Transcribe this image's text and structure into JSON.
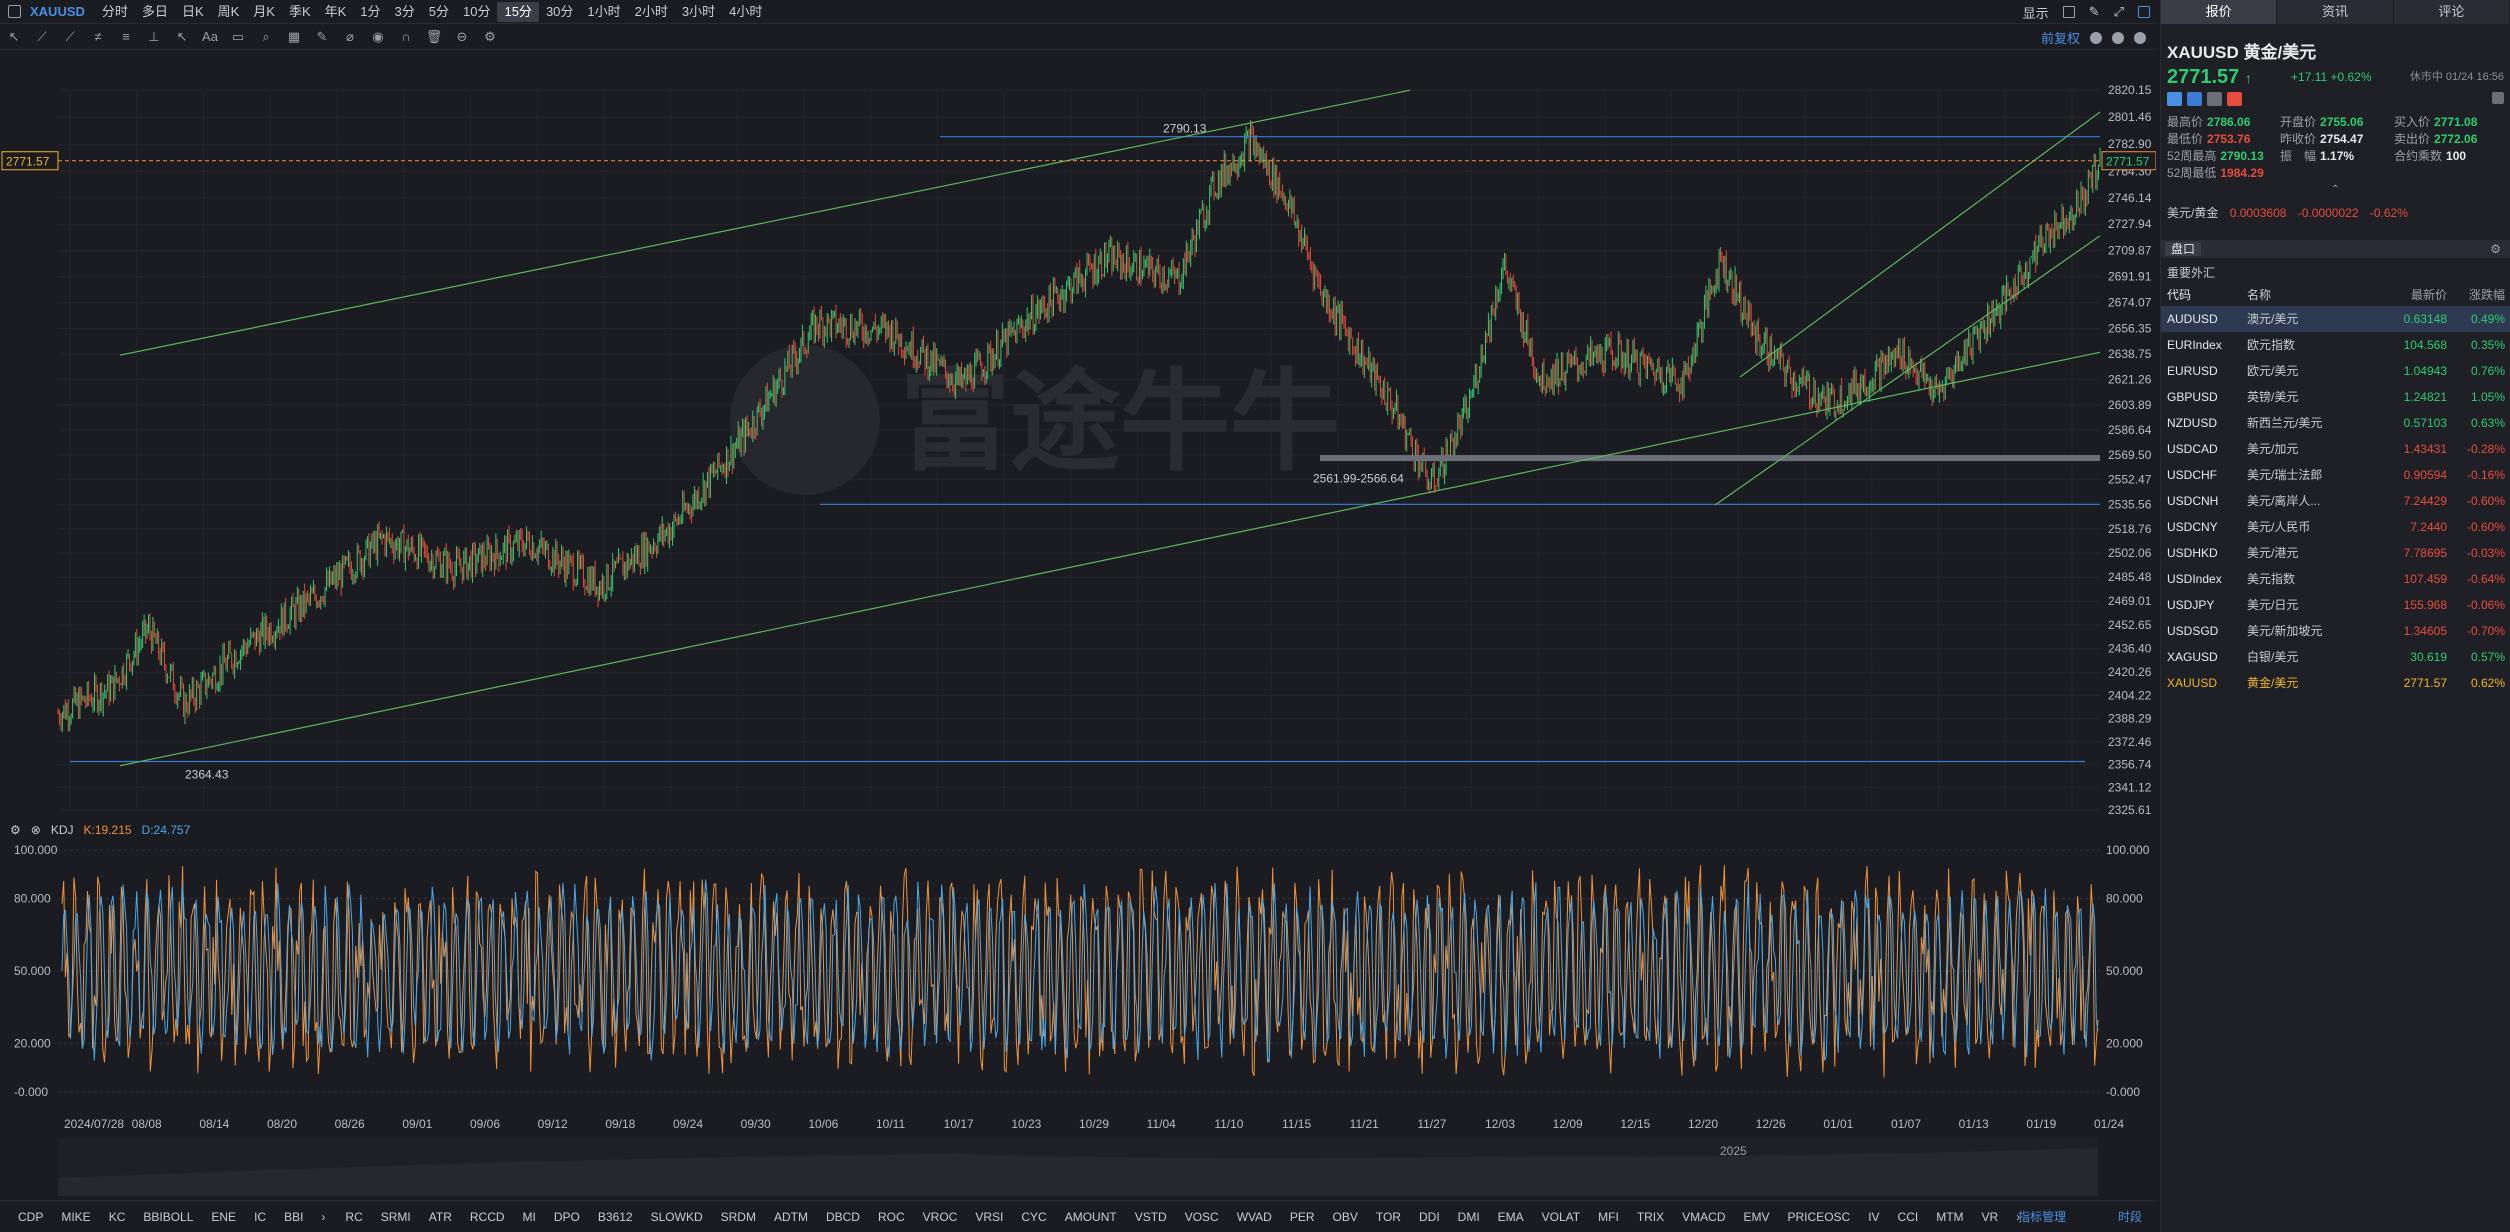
{
  "toolbar": {
    "symbol": "XAUUSD",
    "timeframes": [
      "分时",
      "多日",
      "日K",
      "周K",
      "月K",
      "季K",
      "年K",
      "1分",
      "3分",
      "5分",
      "10分",
      "15分",
      "30分",
      "1小时",
      "2小时",
      "3小时",
      "4小时"
    ],
    "active_timeframe": "15分",
    "display_label": "显示",
    "adjust_label": "前复权"
  },
  "chart_data": [
    {
      "type": "candlestick",
      "x_ticks": [
        "2024/07/28",
        "08/08",
        "08/14",
        "08/20",
        "08/26",
        "09/01",
        "09/06",
        "09/12",
        "09/18",
        "09/24",
        "09/30",
        "10/06",
        "10/11",
        "10/17",
        "10/23",
        "10/29",
        "11/04",
        "11/10",
        "11/15",
        "11/21",
        "11/27",
        "12/03",
        "12/09",
        "12/15",
        "12/20",
        "12/26",
        "01/01",
        "01/07",
        "01/13",
        "01/19",
        "01/24"
      ],
      "y_ticks": [
        2820.15,
        2801.46,
        2782.9,
        2764.3,
        2746.14,
        2727.94,
        2709.87,
        2691.91,
        2674.07,
        2656.35,
        2638.75,
        2621.26,
        2603.89,
        2586.64,
        2569.5,
        2552.47,
        2535.56,
        2518.76,
        2502.06,
        2485.48,
        2469.01,
        2452.65,
        2436.4,
        2420.26,
        2404.22,
        2388.29,
        2372.46,
        2356.74,
        2341.12,
        2325.61
      ],
      "ylim": [
        2325.61,
        2820.15
      ],
      "trend_path": [
        [
          0,
          2392
        ],
        [
          3,
          2410
        ],
        [
          5,
          2450
        ],
        [
          7,
          2398
        ],
        [
          10,
          2435
        ],
        [
          14,
          2470
        ],
        [
          18,
          2512
        ],
        [
          22,
          2492
        ],
        [
          26,
          2510
        ],
        [
          30,
          2480
        ],
        [
          34,
          2520
        ],
        [
          38,
          2583
        ],
        [
          42,
          2660
        ],
        [
          46,
          2655
        ],
        [
          50,
          2618
        ],
        [
          54,
          2666
        ],
        [
          58,
          2705
        ],
        [
          62,
          2690
        ],
        [
          64,
          2755
        ],
        [
          66,
          2786
        ],
        [
          68,
          2745
        ],
        [
          70,
          2680
        ],
        [
          74,
          2600
        ],
        [
          76,
          2548
        ],
        [
          78,
          2600
        ],
        [
          80,
          2700
        ],
        [
          82,
          2622
        ],
        [
          86,
          2640
        ],
        [
          90,
          2620
        ],
        [
          92,
          2705
        ],
        [
          94,
          2650
        ],
        [
          96,
          2622
        ],
        [
          98,
          2605
        ],
        [
          100,
          2620
        ],
        [
          102,
          2640
        ],
        [
          104,
          2610
        ],
        [
          106,
          2650
        ],
        [
          108,
          2680
        ],
        [
          110,
          2720
        ],
        [
          112,
          2744
        ],
        [
          113,
          2771.57
        ]
      ],
      "last_price": "2771.57",
      "annotations": [
        "2790.13",
        "2561.99-2566.64",
        "2364.43"
      ],
      "levels": [
        2790.13,
        2535.56,
        2364.43
      ]
    },
    {
      "type": "line",
      "name": "KDJ",
      "y_ticks": [
        "100.000",
        "80.000",
        "50.000",
        "20.000",
        "-0.000"
      ],
      "ylim": [
        0,
        100
      ]
    }
  ],
  "indicator": {
    "name": "KDJ",
    "k": "K:19.215",
    "d": "D:24.757"
  },
  "nav": {
    "year": "2025"
  },
  "indicators": [
    "CDP",
    "MIKE",
    "KC",
    "BBIBOLL",
    "ENE",
    "IC",
    "BBI",
    "›",
    "RC",
    "SRMI",
    "ATR",
    "RCCD",
    "MI",
    "DPO",
    "B3612",
    "SLOWKD",
    "SRDM",
    "ADTM",
    "DBCD",
    "ROC",
    "VROC",
    "VRSI",
    "CYC",
    "AMOUNT",
    "VSTD",
    "VOSC",
    "WVAD",
    "PER",
    "OBV",
    "TOR",
    "DDI",
    "DMI",
    "EMA",
    "VOLAT",
    "MFI",
    "TRIX",
    "VMACD",
    "EMV",
    "PRICEOSC",
    "IV",
    "CCI",
    "MTM",
    "VR",
    "›"
  ],
  "indicator_manage": "指标管理",
  "timeshare": "时段",
  "panel": {
    "tabs": [
      "报价",
      "资讯",
      "评论"
    ],
    "title": "XAUUSD  黄金/美元",
    "price": "2771.57",
    "change": "+17.11 +0.62%",
    "time": "休市中 01/24 16:56",
    "stats": [
      [
        {
          "l": "最高价",
          "v": "2786.06",
          "c": "up"
        },
        {
          "l": "开盘价",
          "v": "2755.06",
          "c": "up"
        },
        {
          "l": "买入价",
          "v": "2771.08",
          "c": "up"
        }
      ],
      [
        {
          "l": "最低价",
          "v": "2753.76",
          "c": "dn"
        },
        {
          "l": "昨收价",
          "v": "2754.47",
          "c": "wh"
        },
        {
          "l": "卖出价",
          "v": "2772.06",
          "c": "up"
        }
      ],
      [
        {
          "l": "52周最高",
          "v": "2790.13",
          "c": "up"
        },
        {
          "l": "振　幅",
          "v": "1.17%",
          "c": "wh"
        },
        {
          "l": "合约乘数",
          "v": "100",
          "c": "wh"
        }
      ],
      [
        {
          "l": "52周最低",
          "v": "1984.29",
          "c": "dn"
        },
        {
          "l": "",
          "v": "",
          "c": ""
        },
        {
          "l": "",
          "v": "",
          "c": ""
        }
      ]
    ],
    "rate_label": "美元/黄金",
    "rate_value": "0.0003608",
    "rate_change": "-0.0000022",
    "rate_pct": "-0.62%",
    "book_label": "盘口",
    "section": "重要外汇",
    "headers": [
      "代码",
      "名称",
      "最新价",
      "涨跌幅"
    ],
    "rows": [
      {
        "code": "AUDUSD",
        "name": "澳元/美元",
        "price": "0.63148",
        "chg": "0.49%",
        "dir": "up",
        "sel": true
      },
      {
        "code": "EURIndex",
        "name": "欧元指数",
        "price": "104.568",
        "chg": "0.35%",
        "dir": "up"
      },
      {
        "code": "EURUSD",
        "name": "欧元/美元",
        "price": "1.04943",
        "chg": "0.76%",
        "dir": "up"
      },
      {
        "code": "GBPUSD",
        "name": "英镑/美元",
        "price": "1.24821",
        "chg": "1.05%",
        "dir": "up"
      },
      {
        "code": "NZDUSD",
        "name": "新西兰元/美元",
        "price": "0.57103",
        "chg": "0.63%",
        "dir": "up"
      },
      {
        "code": "USDCAD",
        "name": "美元/加元",
        "price": "1.43431",
        "chg": "-0.28%",
        "dir": "dn"
      },
      {
        "code": "USDCHF",
        "name": "美元/瑞士法郎",
        "price": "0.90594",
        "chg": "-0.16%",
        "dir": "dn"
      },
      {
        "code": "USDCNH",
        "name": "美元/离岸人...",
        "price": "7.24429",
        "chg": "-0.60%",
        "dir": "dn"
      },
      {
        "code": "USDCNY",
        "name": "美元/人民币",
        "price": "7.2440",
        "chg": "-0.60%",
        "dir": "dn"
      },
      {
        "code": "USDHKD",
        "name": "美元/港元",
        "price": "7.78695",
        "chg": "-0.03%",
        "dir": "dn"
      },
      {
        "code": "USDIndex",
        "name": "美元指数",
        "price": "107.459",
        "chg": "-0.64%",
        "dir": "dn"
      },
      {
        "code": "USDJPY",
        "name": "美元/日元",
        "price": "155.968",
        "chg": "-0.06%",
        "dir": "dn"
      },
      {
        "code": "USDSGD",
        "name": "美元/新加坡元",
        "price": "1.34605",
        "chg": "-0.70%",
        "dir": "dn"
      },
      {
        "code": "XAGUSD",
        "name": "白银/美元",
        "price": "30.619",
        "chg": "0.57%",
        "dir": "up"
      },
      {
        "code": "XAUUSD",
        "name": "黄金/美元",
        "price": "2771.57",
        "chg": "0.62%",
        "dir": "up",
        "gold": true
      }
    ]
  }
}
